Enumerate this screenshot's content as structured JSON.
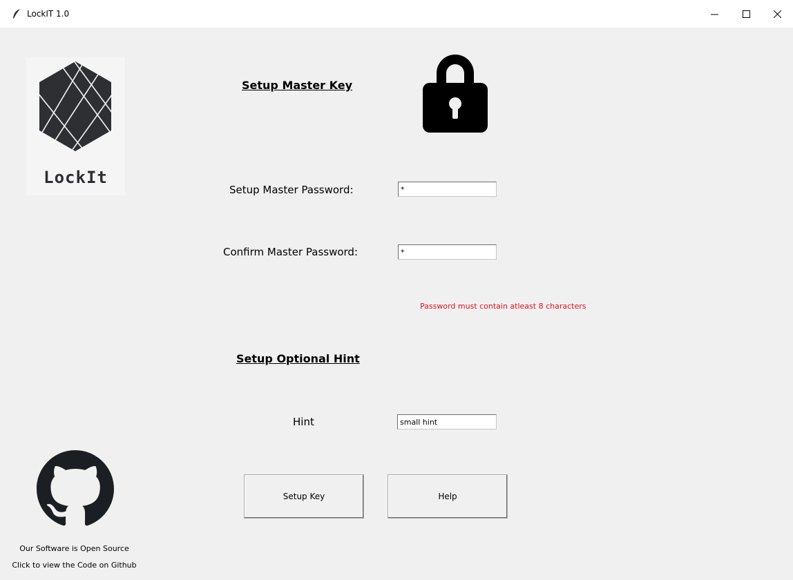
{
  "window": {
    "title": "LockIT 1.0"
  },
  "logo": {
    "text": "LockIt"
  },
  "setup_master": {
    "heading": "Setup Master Key",
    "password_label": "Setup Master Password:",
    "password_value": "*",
    "confirm_label": "Confirm Master Password:",
    "confirm_value": "*",
    "error": "Password must contain atleast 8 characters"
  },
  "hint_section": {
    "heading": "Setup Optional Hint",
    "hint_label": "Hint",
    "hint_value": "small hint"
  },
  "buttons": {
    "setup_key": "Setup Key",
    "help": "Help"
  },
  "footer": {
    "line1": "Our Software is Open Source",
    "line2": "Click to view the Code on Github"
  },
  "colors": {
    "background": "#f0f0f0",
    "error": "#e0101d",
    "logo": "#2d2f33"
  },
  "icons": {
    "app": "feather-icon",
    "lock": "padlock-icon",
    "github": "github-icon"
  }
}
